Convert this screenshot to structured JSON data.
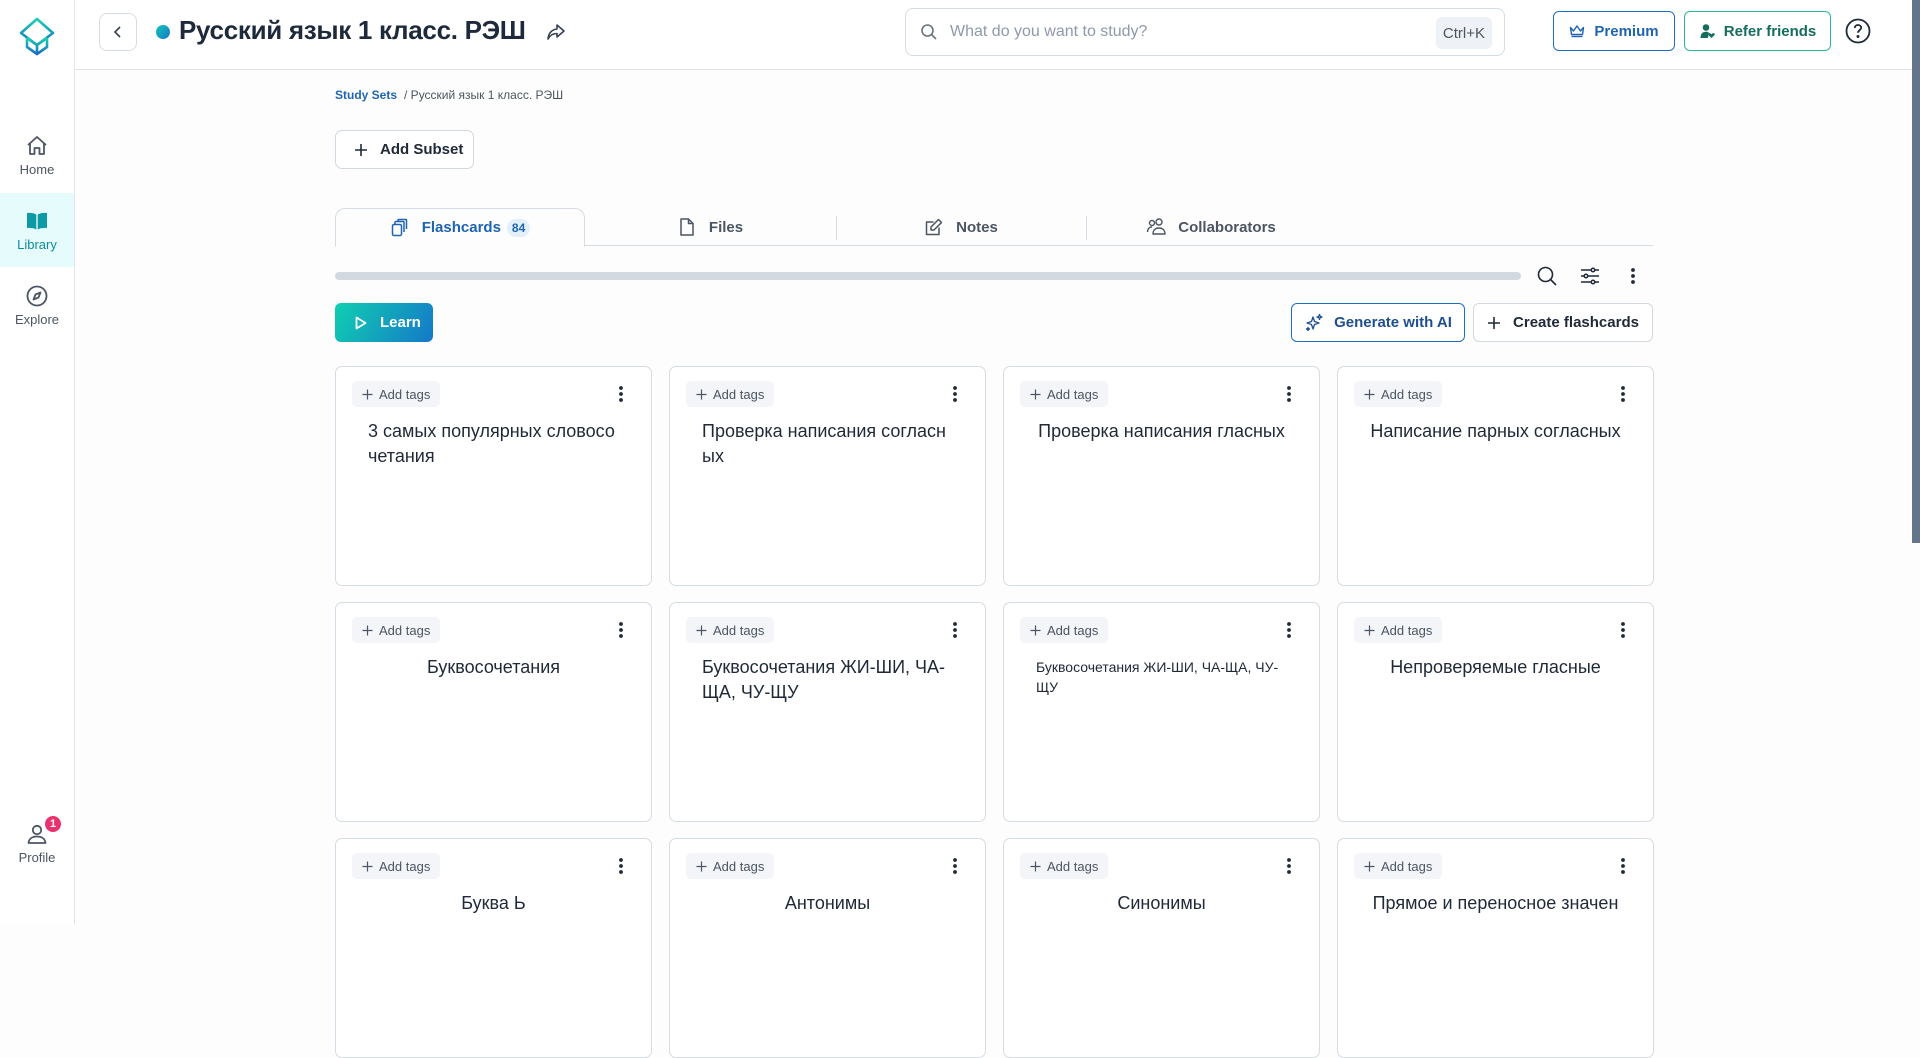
{
  "sidebar": {
    "items": [
      {
        "label": "Home",
        "icon": "home-icon"
      },
      {
        "label": "Library",
        "icon": "book-icon",
        "active": true
      },
      {
        "label": "Explore",
        "icon": "compass-icon"
      }
    ],
    "profile": {
      "label": "Profile",
      "badge": "1"
    }
  },
  "header": {
    "title": "Русский язык 1 класс. РЭШ",
    "search_placeholder": "What do you want to study?",
    "search_value": "",
    "shortcut": "Ctrl+K",
    "premium_label": "Premium",
    "refer_label": "Refer friends"
  },
  "breadcrumb": {
    "root": "Study Sets",
    "current": "/ Русский язык 1 класс. РЭШ"
  },
  "add_subset_label": "Add Subset",
  "tabs": [
    {
      "label": "Flashcards",
      "count": "84",
      "active": true
    },
    {
      "label": "Files"
    },
    {
      "label": "Notes"
    },
    {
      "label": "Collaborators"
    }
  ],
  "actions": {
    "learn": "Learn",
    "generate": "Generate with AI",
    "create": "Create flashcards"
  },
  "cards": [
    {
      "tags_label": "Add tags",
      "text": "3 самых популярных словосо четания",
      "align": "left"
    },
    {
      "tags_label": "Add tags",
      "text": "Проверка написания согласн ых",
      "align": "left"
    },
    {
      "tags_label": "Add tags",
      "text": "Проверка написания гласных",
      "align": "center"
    },
    {
      "tags_label": "Add tags",
      "text": "Написание парных согласных",
      "align": "center"
    },
    {
      "tags_label": "Add tags",
      "text": "Буквосочетания",
      "align": "center"
    },
    {
      "tags_label": "Add tags",
      "text": "Буквосочетания ЖИ-ШИ, ЧА-ЩА, ЧУ-ЩУ",
      "align": "left"
    },
    {
      "tags_label": "Add tags",
      "text": "Буквосочетания ЖИ-ШИ, ЧА-ЩА, ЧУ-ЩУ",
      "align": "small"
    },
    {
      "tags_label": "Add tags",
      "text": "Непроверяемые гласные",
      "align": "center"
    },
    {
      "tags_label": "Add tags",
      "text": "Буква Ь",
      "align": "center"
    },
    {
      "tags_label": "Add tags",
      "text": "Антонимы",
      "align": "center"
    },
    {
      "tags_label": "Add tags",
      "text": "Синонимы",
      "align": "center"
    },
    {
      "tags_label": "Add tags",
      "text": "Прямое и переносное значен",
      "align": "center"
    }
  ],
  "colors": {
    "brand_teal": "#0e8c9a",
    "primary_blue": "#1f64b3",
    "refer_green": "#2ab89a",
    "badge_pink": "#e8336e"
  }
}
